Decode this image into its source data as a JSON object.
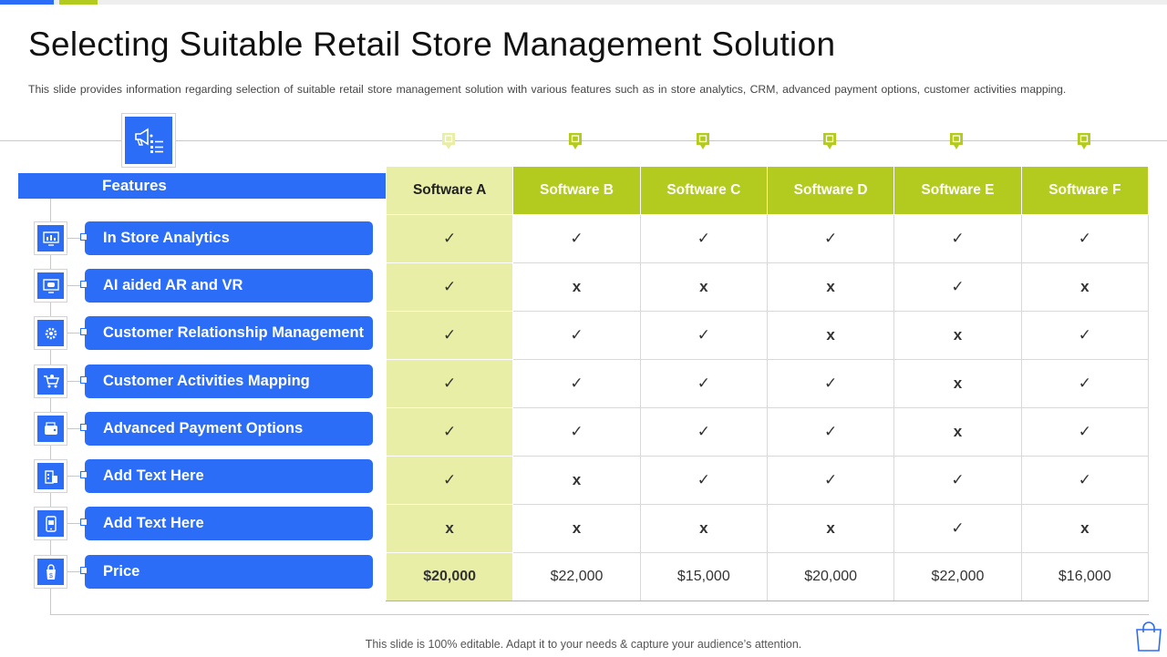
{
  "slide": {
    "title": "Selecting Suitable Retail Store Management Solution",
    "subtitle": "This slide provides  information regarding  selection of suitable retail store management  solution with various features  such as in store analytics, CRM,  advanced  payment options,  customer activities  mapping.",
    "footer": "This slide is 100% editable. Adapt it to your needs & capture your audience’s attention."
  },
  "colors": {
    "blue": "#2b6df6",
    "green": "#b3cb1f",
    "light_green": "#e8eea6"
  },
  "features_header": "Features",
  "features": [
    {
      "label": "In Store Analytics",
      "icon": "monitor-analytics-icon"
    },
    {
      "label": "AI aided AR and VR",
      "icon": "vr-monitor-icon"
    },
    {
      "label": "Customer Relationship Management",
      "icon": "gear-people-icon"
    },
    {
      "label": "Customer Activities  Mapping",
      "icon": "shopping-cart-icon"
    },
    {
      "label": "Advanced Payment Options",
      "icon": "wallet-card-icon"
    },
    {
      "label": "Add Text Here",
      "icon": "store-building-icon"
    },
    {
      "label": "Add Text Here",
      "icon": "mobile-shop-icon"
    },
    {
      "label": "Price",
      "icon": "price-tag-bag-icon"
    }
  ],
  "software": [
    "Software A",
    "Software B",
    "Software C",
    "Software D",
    "Software E",
    "Software F"
  ],
  "symbols": {
    "yes": "✓",
    "no": "x"
  },
  "matrix": [
    [
      "yes",
      "yes",
      "yes",
      "yes",
      "yes",
      "yes"
    ],
    [
      "yes",
      "no",
      "no",
      "no",
      "yes",
      "no"
    ],
    [
      "yes",
      "yes",
      "yes",
      "no",
      "no",
      "yes"
    ],
    [
      "yes",
      "yes",
      "yes",
      "yes",
      "no",
      "yes"
    ],
    [
      "yes",
      "yes",
      "yes",
      "yes",
      "no",
      "yes"
    ],
    [
      "yes",
      "no",
      "yes",
      "yes",
      "yes",
      "yes"
    ],
    [
      "no",
      "no",
      "no",
      "no",
      "yes",
      "no"
    ]
  ],
  "prices": [
    "$20,000",
    "$22,000",
    "$15,000",
    "$20,000",
    "$22,000",
    "$16,000"
  ]
}
